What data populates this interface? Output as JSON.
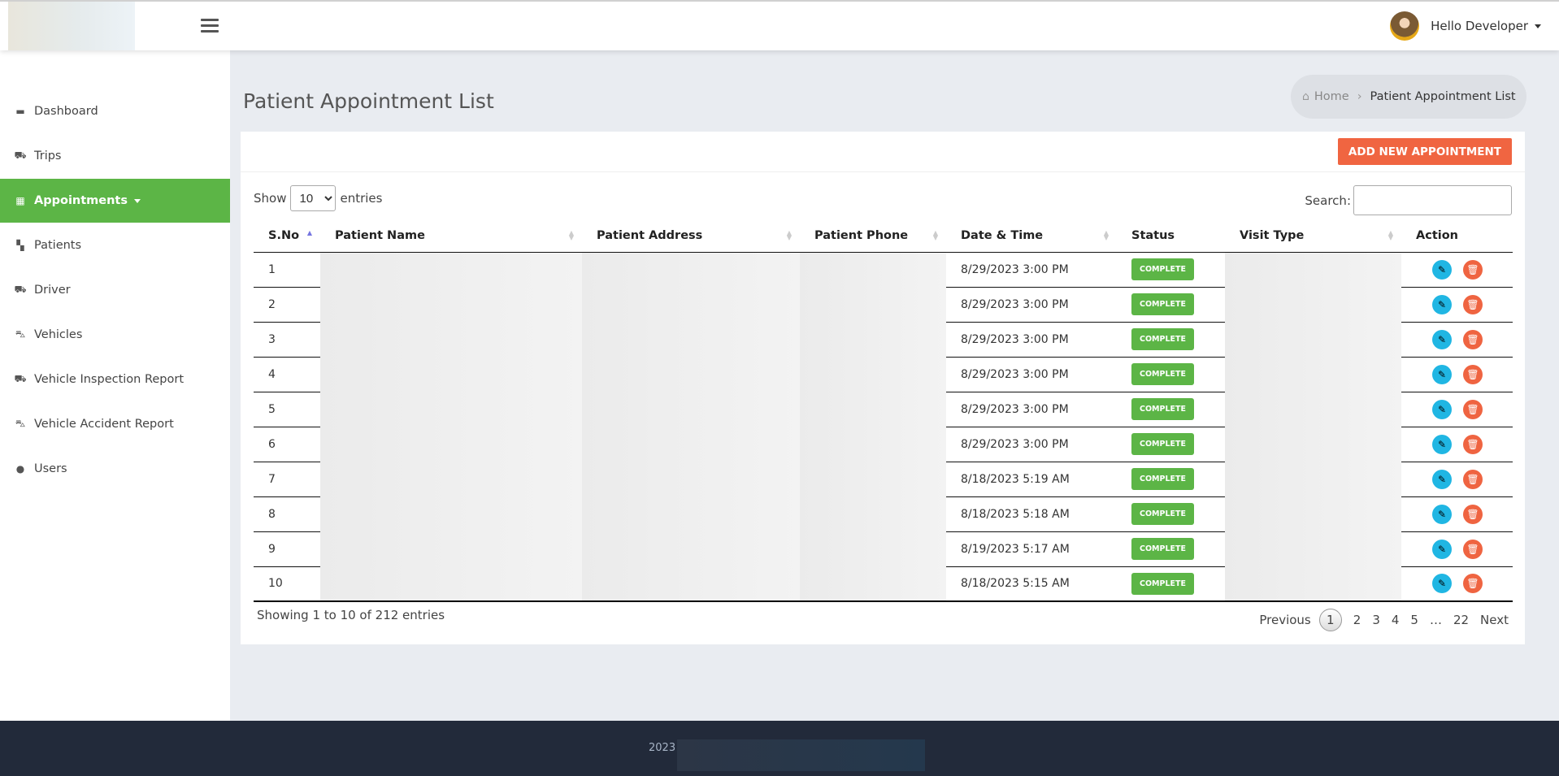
{
  "header": {
    "user_greeting": "Hello Developer"
  },
  "sidebar": {
    "items": [
      {
        "label": "Dashboard",
        "icon": "briefcase-icon",
        "glyph": "▬"
      },
      {
        "label": "Trips",
        "icon": "car-icon",
        "glyph": "⛟"
      },
      {
        "label": "Appointments",
        "icon": "calendar-icon",
        "glyph": "▦",
        "active": true
      },
      {
        "label": "Patients",
        "icon": "hospital-user-icon",
        "glyph": "▚"
      },
      {
        "label": "Driver",
        "icon": "car-icon",
        "glyph": "⛟"
      },
      {
        "label": "Vehicles",
        "icon": "shuttle-van-icon",
        "glyph": "⛍"
      },
      {
        "label": "Vehicle Inspection Report",
        "icon": "car-icon",
        "glyph": "⛟"
      },
      {
        "label": "Vehicle Accident Report",
        "icon": "shuttle-van-icon",
        "glyph": "⛍"
      },
      {
        "label": "Users",
        "icon": "user-icon",
        "glyph": "●"
      }
    ]
  },
  "page": {
    "title": "Patient Appointment List",
    "breadcrumb": {
      "home": "Home",
      "current": "Patient Appointment List"
    },
    "add_button": "ADD NEW APPOINTMENT"
  },
  "table": {
    "show_label": "Show",
    "entries_label": "entries",
    "page_length": "10",
    "search_label": "Search:",
    "search_value": "",
    "columns": [
      "S.No",
      "Patient Name",
      "Patient Address",
      "Patient Phone",
      "Date & Time",
      "Status",
      "Visit Type",
      "Action"
    ],
    "rows": [
      {
        "sno": "1",
        "datetime": "8/29/2023 3:00 PM",
        "status": "COMPLETE"
      },
      {
        "sno": "2",
        "datetime": "8/29/2023 3:00 PM",
        "status": "COMPLETE"
      },
      {
        "sno": "3",
        "datetime": "8/29/2023 3:00 PM",
        "status": "COMPLETE"
      },
      {
        "sno": "4",
        "datetime": "8/29/2023 3:00 PM",
        "status": "COMPLETE"
      },
      {
        "sno": "5",
        "datetime": "8/29/2023 3:00 PM",
        "status": "COMPLETE"
      },
      {
        "sno": "6",
        "datetime": "8/29/2023 3:00 PM",
        "status": "COMPLETE"
      },
      {
        "sno": "7",
        "datetime": "8/18/2023 5:19 AM",
        "status": "COMPLETE"
      },
      {
        "sno": "8",
        "datetime": "8/18/2023 5:18 AM",
        "status": "COMPLETE"
      },
      {
        "sno": "9",
        "datetime": "8/19/2023 5:17 AM",
        "status": "COMPLETE"
      },
      {
        "sno": "10",
        "datetime": "8/18/2023 5:15 AM",
        "status": "COMPLETE"
      }
    ],
    "info": "Showing 1 to 10 of 212 entries",
    "pagination": {
      "previous": "Previous",
      "pages": [
        "1",
        "2",
        "3",
        "4",
        "5",
        "…",
        "22"
      ],
      "current": "1",
      "next": "Next"
    }
  },
  "footer": {
    "year": "2023"
  },
  "colors": {
    "accent_green": "#5cb546",
    "add_button": "#f06541",
    "edit": "#20b6e3",
    "delete": "#ef6441",
    "footer": "#222a3a"
  }
}
